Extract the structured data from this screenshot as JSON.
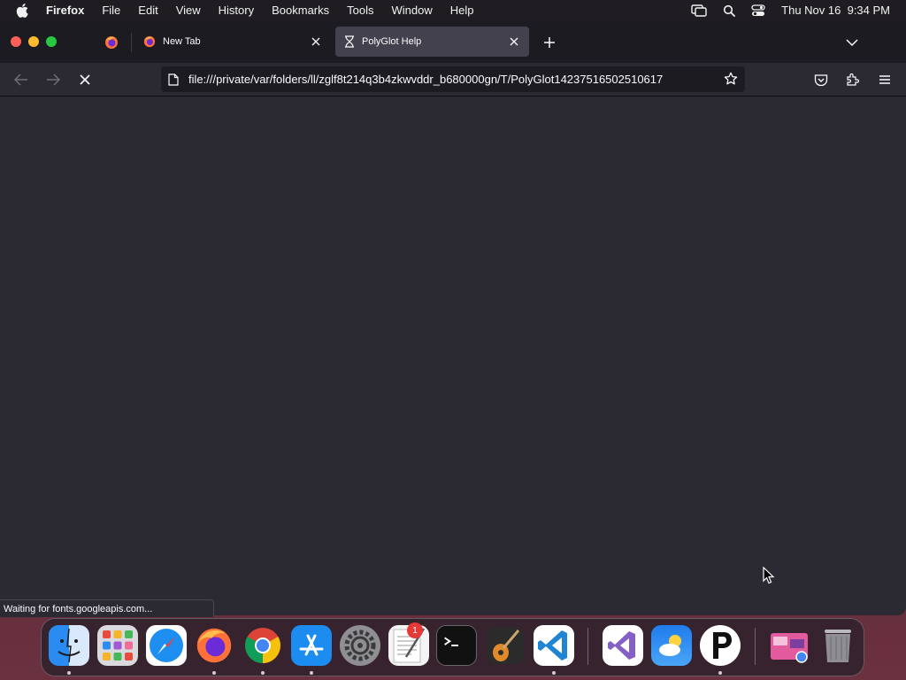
{
  "menubar": {
    "app_name": "Firefox",
    "items": [
      "File",
      "Edit",
      "View",
      "History",
      "Bookmarks",
      "Tools",
      "Window",
      "Help"
    ],
    "clock": "Thu Nov 16  9:34 PM"
  },
  "tabs": [
    {
      "title": "New Tab",
      "icon": "firefox-icon",
      "active": false
    },
    {
      "title": "PolyGlot Help",
      "icon": "hourglass-icon",
      "active": true
    }
  ],
  "navbar": {
    "url": "file:///private/var/folders/ll/zglf8t214q3b4zkwvddr_b680000gn/T/PolyGlot14237516502510617"
  },
  "status": {
    "text": "Waiting for fonts.googleapis.com..."
  },
  "dock": {
    "apps": [
      "Finder",
      "Launchpad",
      "Safari",
      "Firefox",
      "Chrome",
      "App Store",
      "System Settings",
      "TextEdit",
      "Terminal",
      "GarageBand",
      "Visual Studio Code",
      "Visual Studio",
      "Weather",
      "PolyGlot",
      "Downloads",
      "Trash"
    ],
    "system_settings_badge": "1"
  },
  "colors": {
    "chrome_bg": "#1c1b22",
    "content_bg": "#2b2a33",
    "active_tab": "#42414d"
  }
}
